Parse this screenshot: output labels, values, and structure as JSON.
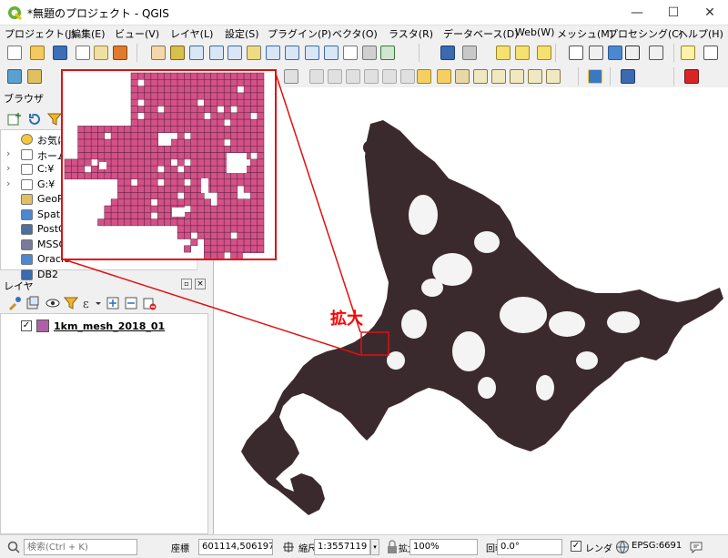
{
  "window": {
    "title": "*無題のプロジェクト - QGIS",
    "minimize": "—",
    "maximize": "☐",
    "close": "✕"
  },
  "menu": [
    "プロジェクト(J)",
    "編集(E)",
    "ビュー(V)",
    "レイヤ(L)",
    "設定(S)",
    "プラグイン(P)",
    "ベクタ(O)",
    "ラスタ(R)",
    "データベース(D)",
    "Web(W)",
    "メッシュ(M)",
    "プロセシング(C)",
    "ヘルプ(H)"
  ],
  "browser": {
    "title": "ブラウザ",
    "items": [
      {
        "label": "お気に入り",
        "icon": "star-icon"
      },
      {
        "label": "ホーム",
        "icon": "home-icon"
      },
      {
        "label": "C:¥",
        "icon": "folder-icon"
      },
      {
        "label": "G:¥",
        "icon": "folder-icon"
      },
      {
        "label": "GeoPackage",
        "icon": "geopackage-icon"
      },
      {
        "label": "SpatiaLite",
        "icon": "spatialite-icon"
      },
      {
        "label": "PostGIS",
        "icon": "postgis-icon"
      },
      {
        "label": "MSSQL",
        "icon": "mssql-icon"
      },
      {
        "label": "Oracle",
        "icon": "oracle-icon"
      },
      {
        "label": "DB2",
        "icon": "db2-icon"
      }
    ]
  },
  "layers": {
    "title": "レイヤ",
    "items": [
      {
        "name": "1km_mesh_2018_01",
        "checked": true,
        "color": "#b15fa8"
      }
    ]
  },
  "annotation": {
    "label": "拡大",
    "color": "#ff0000"
  },
  "map": {
    "fill_color": "#3b2a2d",
    "mesh_color": "#d45187"
  },
  "status": {
    "search_placeholder": "検索(Ctrl + K)",
    "coordinate_label": "座標",
    "coordinate": "601114,5061970",
    "scale_label": "縮尺",
    "scale": "1:3557119",
    "magnifier_label": "拡大",
    "magnifier": "100%",
    "rotation_label": "回転",
    "rotation": "0.0°",
    "render_label": "レンダ",
    "render_checked": true,
    "crs": "EPSG:6691"
  }
}
